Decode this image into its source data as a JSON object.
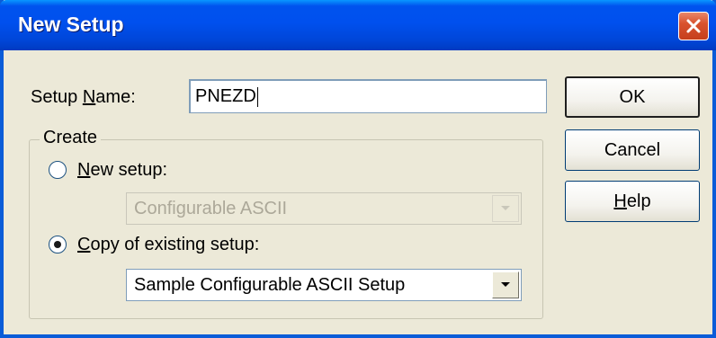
{
  "window": {
    "title": "New Setup",
    "close_icon": "close-icon"
  },
  "setup_name": {
    "label_prefix": "Setup ",
    "label_mnemonic": "N",
    "label_suffix": "ame:",
    "value": "PNEZD"
  },
  "create_group": {
    "legend": "Create",
    "new_setup": {
      "mnemonic": "N",
      "label_rest": "ew setup:",
      "selected": false,
      "combo_value": "Configurable ASCII",
      "combo_enabled": false
    },
    "copy_setup": {
      "mnemonic": "C",
      "label_rest": "opy of existing setup:",
      "selected": true,
      "combo_value": "Sample Configurable ASCII Setup",
      "combo_enabled": true
    }
  },
  "buttons": {
    "ok": "OK",
    "cancel": "Cancel",
    "help_mnemonic": "H",
    "help_rest": "elp"
  },
  "colors": {
    "titlebar": "#0053ee",
    "window_bg": "#ece9d8",
    "close_button": "#d9532e"
  }
}
